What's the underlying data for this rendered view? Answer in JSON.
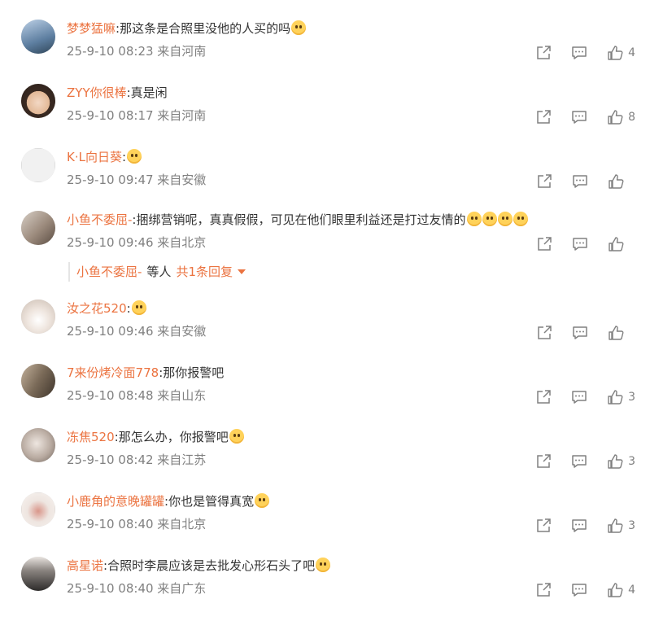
{
  "comments": [
    {
      "username": "梦梦猛嘛",
      "text": "那这条是合照里没他的人买的吗",
      "emoji": "laugh-cry-emoji",
      "meta": "25-9-10 08:23 来自河南",
      "likes": "4",
      "avatar_color": "#5d7ea0"
    },
    {
      "username": "ZYY你很棒",
      "text": "真是闲",
      "emoji": "",
      "meta": "25-9-10 08:17 来自河南",
      "likes": "8",
      "avatar_color": "#c9a48a"
    },
    {
      "username": "K·L向日葵",
      "text": "",
      "emoji": "cat-emoji",
      "meta": "25-9-10 09:47 来自安徽",
      "likes": "",
      "avatar_color": "#e8e8e8"
    },
    {
      "username": "小鱼不委屈-",
      "text": "捆绑营销呢，真真假假，可见在他们眼里利益还是打过友情的",
      "emoji": "dizzy-emoji x4",
      "meta": "25-9-10 09:46 来自北京",
      "likes": "",
      "avatar_color": "#9b8a7c"
    },
    {
      "username": "汝之花520",
      "text": "",
      "emoji": "cat-emoji",
      "meta": "25-9-10 09:46 来自安徽",
      "likes": "",
      "avatar_color": "#d9cfc8"
    },
    {
      "username": "7来份烤冷面778",
      "text": "那你报警吧",
      "emoji": "",
      "meta": "25-9-10 08:48 来自山东",
      "likes": "3",
      "avatar_color": "#7a6a58"
    },
    {
      "username": "冻焦520",
      "text": "那怎么办，你报警吧",
      "emoji": "cat-emoji",
      "meta": "25-9-10 08:42 来自江苏",
      "likes": "3",
      "avatar_color": "#b8aaa0"
    },
    {
      "username": "小鹿角的意晚罐罐",
      "text": "你也是管得真宽",
      "emoji": "sweat-emoji",
      "meta": "25-9-10 08:40 来自北京",
      "likes": "3",
      "avatar_color": "#eee5e0"
    },
    {
      "username": "高星诺",
      "text": "合照时李晨应该是去批发心形石头了吧",
      "emoji": "cat-emoji",
      "meta": "25-9-10 08:40 来自广东",
      "likes": "4",
      "avatar_color": "#3b3b3b"
    }
  ],
  "reply_summary": {
    "name": "小鱼不委屈-",
    "text": "等人",
    "total": "共1条回复"
  },
  "colors": {
    "username": "#eb7340",
    "meta": "#808080",
    "text": "#333333"
  },
  "icons": [
    "share-icon",
    "comment-icon",
    "like-icon"
  ]
}
